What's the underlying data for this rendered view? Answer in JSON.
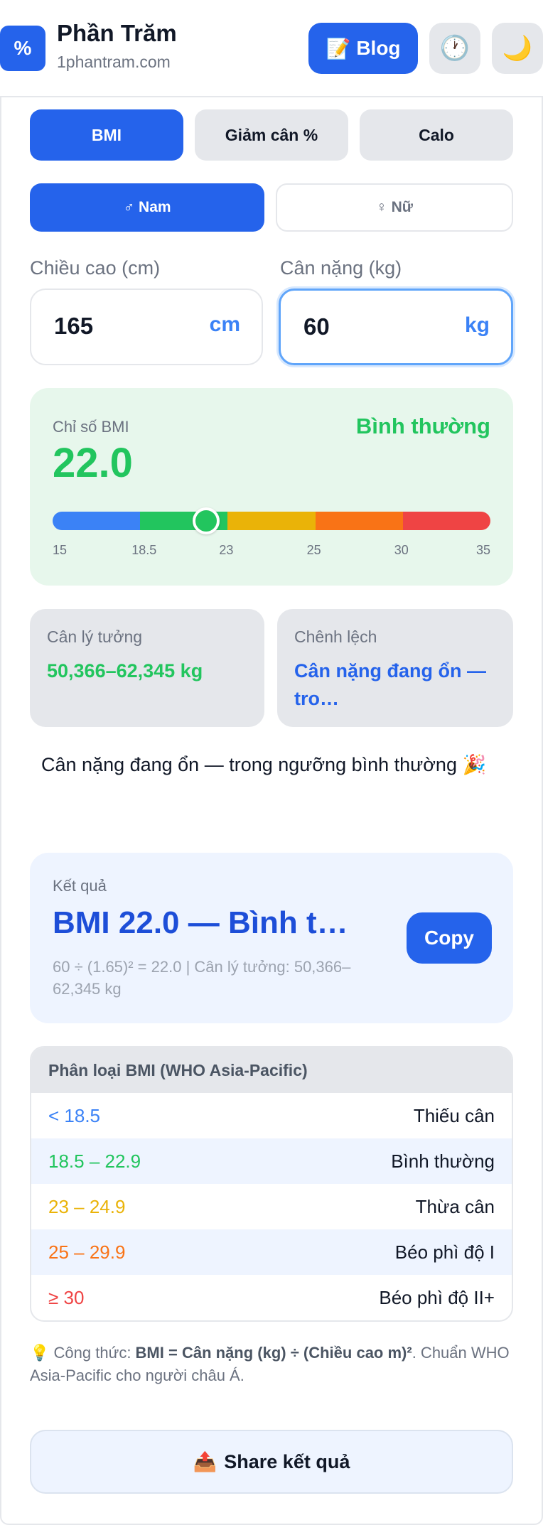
{
  "header": {
    "logo_text": "%",
    "title": "Phần Trăm",
    "subtitle": "1phantram.com",
    "blog_icon": "📝",
    "blog_label": "Blog",
    "history_icon": "🕐",
    "theme_icon": "🌙"
  },
  "tabs": [
    {
      "label": "BMI",
      "active": true
    },
    {
      "label": "Giảm cân %",
      "active": false
    },
    {
      "label": "Calo",
      "active": false
    }
  ],
  "gender": {
    "male": "♂ Nam",
    "female": "♀ Nữ",
    "selected": "male"
  },
  "inputs": {
    "height": {
      "label": "Chiều cao (cm)",
      "value": "165",
      "unit": "cm"
    },
    "weight": {
      "label": "Cân nặng (kg)",
      "value": "60",
      "unit": "kg"
    }
  },
  "bmi": {
    "label": "Chỉ số BMI",
    "value": "22.0",
    "status": "Bình thường",
    "marker_fraction": 0.35,
    "scale_ticks": [
      "15",
      "18.5",
      "23",
      "25",
      "30",
      "35"
    ],
    "scale_colors": [
      "#3b82f6",
      "#22c55e",
      "#eab308",
      "#f97316",
      "#ef4444"
    ]
  },
  "stats": {
    "ideal": {
      "label": "Cân lý tưởng",
      "value": "50,366–62,345 kg"
    },
    "diff": {
      "label": "Chênh lệch",
      "value": "Cân nặng đang ổn — tro…"
    }
  },
  "message": "Cân nặng đang ổn — trong ngưỡng bình thường 🎉",
  "result": {
    "label": "Kết quả",
    "main": "BMI 22.0 — Bình t…",
    "sub": "60 ÷ (1.65)² = 22.0 | Cân lý tưởng: 50,366–62,345 kg",
    "copy_label": "Copy"
  },
  "classification": {
    "title": "Phân loại BMI (WHO Asia-Pacific)",
    "rows": [
      {
        "range": "< 18.5",
        "label": "Thiếu cân",
        "color": "#3b82f6"
      },
      {
        "range": "18.5 – 22.9",
        "label": "Bình thường",
        "color": "#22c55e"
      },
      {
        "range": "23 – 24.9",
        "label": "Thừa cân",
        "color": "#eab308"
      },
      {
        "range": "25 – 29.9",
        "label": "Béo phì độ I",
        "color": "#f97316"
      },
      {
        "range": "≥ 30",
        "label": "Béo phì độ II+",
        "color": "#ef4444"
      }
    ]
  },
  "formula": {
    "icon": "💡",
    "prefix": "Công thức: ",
    "bold": "BMI = Cân nặng (kg) ÷ (Chiều cao m)²",
    "suffix": ". Chuẩn WHO Asia-Pacific cho người châu Á."
  },
  "share": {
    "icon": "📤",
    "label": "Share kết quả"
  }
}
